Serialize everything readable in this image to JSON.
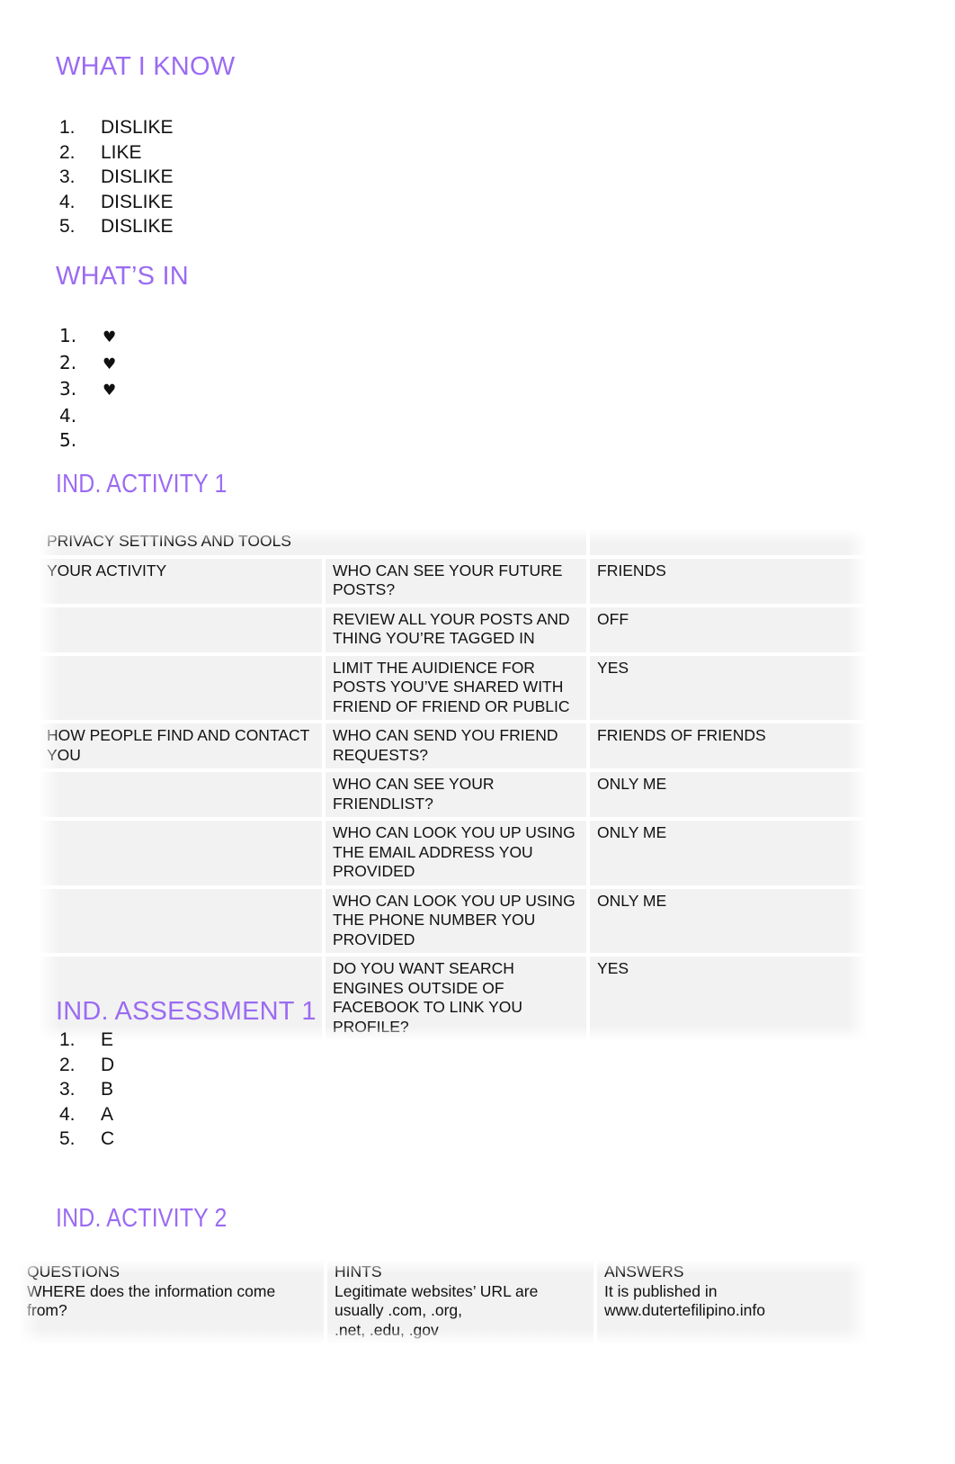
{
  "sections": {
    "what_i_know": {
      "heading": "WHAT I KNOW",
      "items": [
        {
          "num": "1.",
          "value": "DISLIKE"
        },
        {
          "num": "2.",
          "value": "LIKE"
        },
        {
          "num": "3.",
          "value": "DISLIKE"
        },
        {
          "num": "4.",
          "value": "DISLIKE"
        },
        {
          "num": "5.",
          "value": "DISLIKE"
        }
      ]
    },
    "whats_in": {
      "heading": "WHAT’S IN",
      "items": [
        {
          "num": "1.",
          "value": "♥"
        },
        {
          "num": "2.",
          "value": "♥"
        },
        {
          "num": "3.",
          "value": "♥"
        },
        {
          "num": "4.",
          "value": ""
        },
        {
          "num": "5.",
          "value": ""
        }
      ]
    },
    "ind_activity_1": {
      "heading": "IND. ACTIVITY 1",
      "table": {
        "title": "PRIVACY SETTINGS AND TOOLS",
        "rows": [
          {
            "category": "YOUR ACTIVITY",
            "question": "WHO CAN SEE YOUR FUTURE POSTS?",
            "answer": "FRIENDS"
          },
          {
            "category": "",
            "question": "REVIEW ALL YOUR POSTS AND THING YOU’RE TAGGED IN",
            "answer": "OFF"
          },
          {
            "category": "",
            "question": "LIMIT THE AUIDIENCE FOR POSTS YOU’VE SHARED WITH FRIEND OF FRIEND OR PUBLIC",
            "answer": "YES"
          },
          {
            "category": "HOW PEOPLE FIND AND CONTACT YOU",
            "question": "WHO CAN SEND YOU FRIEND REQUESTS?",
            "answer": "FRIENDS OF FRIENDS"
          },
          {
            "category": "",
            "question": "WHO CAN SEE YOUR FRIENDLIST?",
            "answer": "ONLY ME"
          },
          {
            "category": "",
            "question": "WHO CAN LOOK YOU UP USING THE EMAIL ADDRESS YOU PROVIDED",
            "answer": "ONLY ME"
          },
          {
            "category": "",
            "question": "WHO CAN LOOK YOU UP USING THE PHONE NUMBER YOU PROVIDED",
            "answer": "ONLY ME"
          },
          {
            "category": "",
            "question": "DO YOU WANT SEARCH ENGINES OUTSIDE OF FACEBOOK TO LINK YOU PROFILE?",
            "answer": "YES"
          }
        ]
      }
    },
    "ind_assessment_1": {
      "heading": "IND. ASSESSMENT 1",
      "items": [
        {
          "num": "1.",
          "value": "E"
        },
        {
          "num": "2.",
          "value": "D"
        },
        {
          "num": "3.",
          "value": "B"
        },
        {
          "num": "4.",
          "value": "A"
        },
        {
          "num": "5.",
          "value": "C"
        }
      ]
    },
    "ind_activity_2": {
      "heading": "IND. ACTIVITY 2",
      "table": {
        "headers": [
          "QUESTIONS",
          "HINTS",
          "ANSWERS"
        ],
        "row": {
          "question": "WHERE does the information come from?",
          "hint": "Legitimate websites’ URL are usually .com, .org,\n.net, .edu, .gov",
          "answer": "It is published in www.dutertefilipino.info"
        }
      }
    }
  },
  "colors": {
    "heading_purple": "#9B6BF2",
    "table_cell_bg": "#f2f2f2",
    "text": "#111111",
    "page_bg": "#ffffff"
  }
}
